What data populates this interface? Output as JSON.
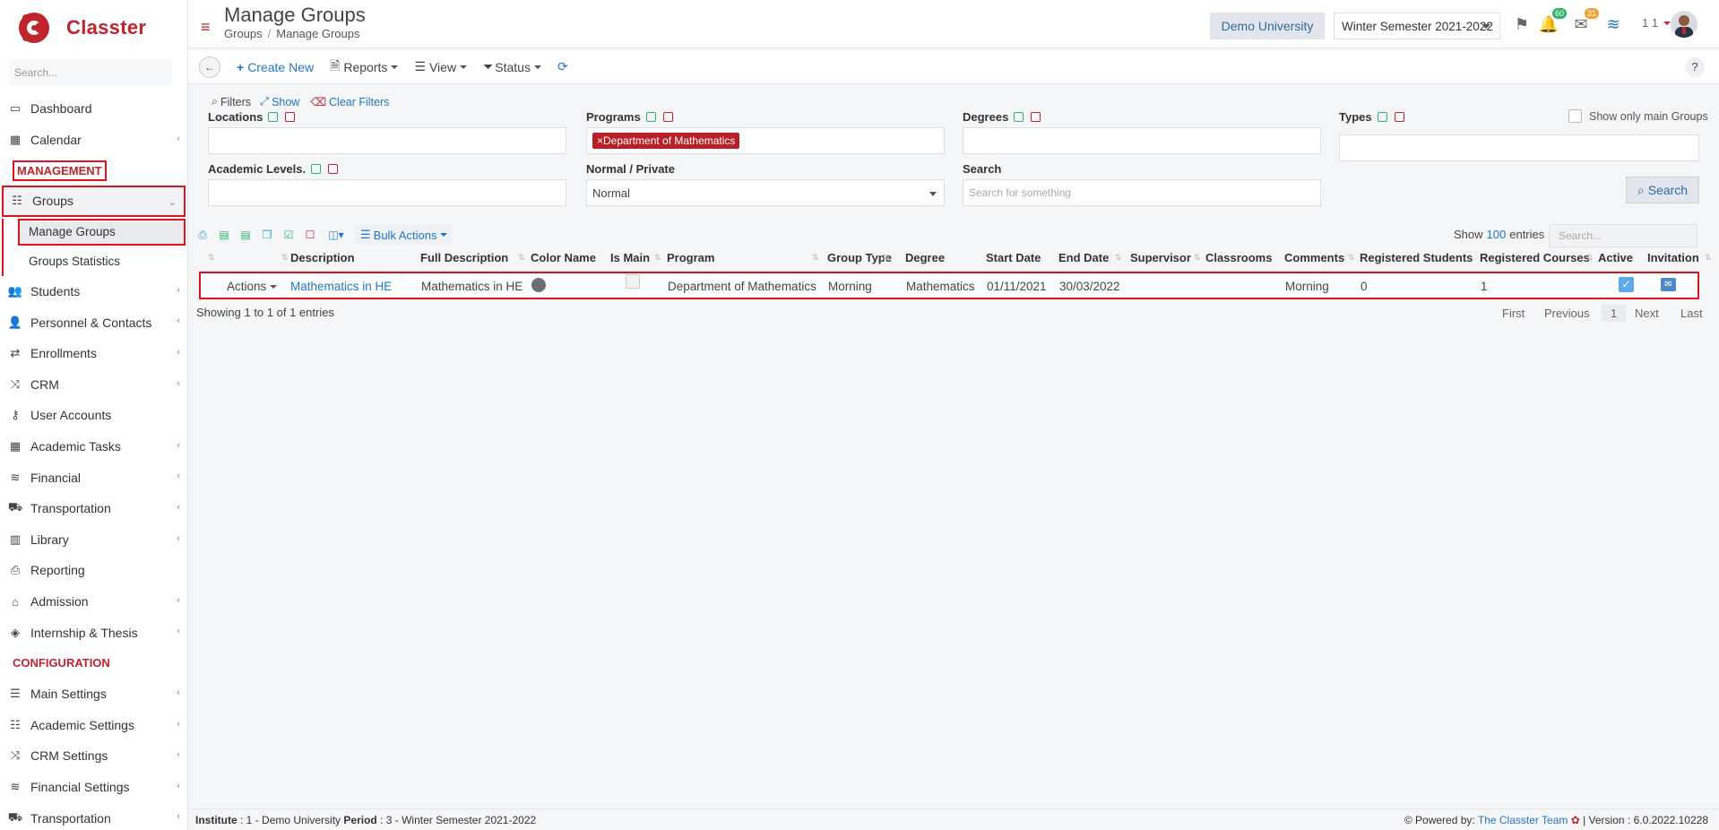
{
  "brand": {
    "name": "Classter",
    "search_placeholder": "Search..."
  },
  "sidebar": {
    "items_top": [
      {
        "label": "Dashboard",
        "icon": "laptop-icon"
      },
      {
        "label": "Calendar",
        "icon": "calendar-icon"
      }
    ],
    "section_management": "MANAGEMENT",
    "groups_label": "Groups",
    "sub_items": [
      "Manage Groups",
      "Groups Statistics"
    ],
    "items_mgmt": [
      {
        "label": "Students"
      },
      {
        "label": "Personnel & Contacts"
      },
      {
        "label": "Enrollments"
      },
      {
        "label": "CRM"
      },
      {
        "label": "User Accounts"
      },
      {
        "label": "Academic Tasks"
      },
      {
        "label": "Financial"
      },
      {
        "label": "Transportation"
      },
      {
        "label": "Library"
      },
      {
        "label": "Reporting"
      },
      {
        "label": "Admission"
      },
      {
        "label": "Internship & Thesis"
      }
    ],
    "section_configuration": "CONFIGURATION",
    "items_config": [
      {
        "label": "Main Settings"
      },
      {
        "label": "Academic Settings"
      },
      {
        "label": "CRM Settings"
      },
      {
        "label": "Financial Settings"
      },
      {
        "label": "Transportation"
      }
    ]
  },
  "header": {
    "title": "Manage Groups",
    "breadcrumb": [
      "Groups",
      "Manage Groups"
    ],
    "university": "Demo University",
    "semester": "Winter Semester 2021-2022",
    "notifications_count": "60",
    "messages_count": "31",
    "user_num": "1 1"
  },
  "toolbar": {
    "create_new": "Create New",
    "reports": "Reports",
    "view": "View",
    "status": "Status",
    "help": "?"
  },
  "filters": {
    "title": "Filters",
    "show": "Show",
    "clear": "Clear Filters",
    "locations": "Locations",
    "programs": "Programs",
    "programs_tag": "Department of Mathematics",
    "degrees": "Degrees",
    "types": "Types",
    "only_main": "Show only main Groups",
    "academic_levels": "Academic Levels.",
    "normal_private": "Normal / Private",
    "normal_private_value": "Normal",
    "search": "Search",
    "search_placeholder": "Search for something",
    "search_button": "Search"
  },
  "table": {
    "bulk_actions": "Bulk Actions",
    "show": "Show",
    "entries_count": "100",
    "entries": "entries",
    "search_placeholder": "Search...",
    "columns": [
      "Description",
      "Full Description",
      "Color Name",
      "Is Main",
      "Program",
      "Group Type",
      "Degree",
      "Start Date",
      "End Date",
      "Supervisor",
      "Classrooms",
      "Comments",
      "Registered Students",
      "Registered Courses",
      "Active",
      "Invitation"
    ],
    "row": {
      "actions": "Actions",
      "description": "Mathematics in HE",
      "full_description": "Mathematics in HE",
      "program": "Department of Mathematics",
      "group_type": "Morning",
      "degree": "Mathematics",
      "start_date": "01/11/2021",
      "end_date": "30/03/2022",
      "comments": "Morning",
      "registered_students": "0",
      "registered_courses": "1"
    },
    "showing": "Showing 1 to 1 of 1 entries",
    "pager": [
      "First",
      "Previous",
      "1",
      "Next",
      "Last"
    ]
  },
  "footer": {
    "institute_label": "Institute",
    "institute_value": ": 1 - Demo University",
    "period_label": "Period",
    "period_value": ": 3 - Winter Semester 2021-2022",
    "powered": "Powered by:",
    "team": "The Classter Team",
    "version": "| Version : 6.0.2022.10228"
  },
  "colors": {
    "accent": "#c0242c",
    "link": "#2177c4",
    "highlight": "#e0121d"
  }
}
